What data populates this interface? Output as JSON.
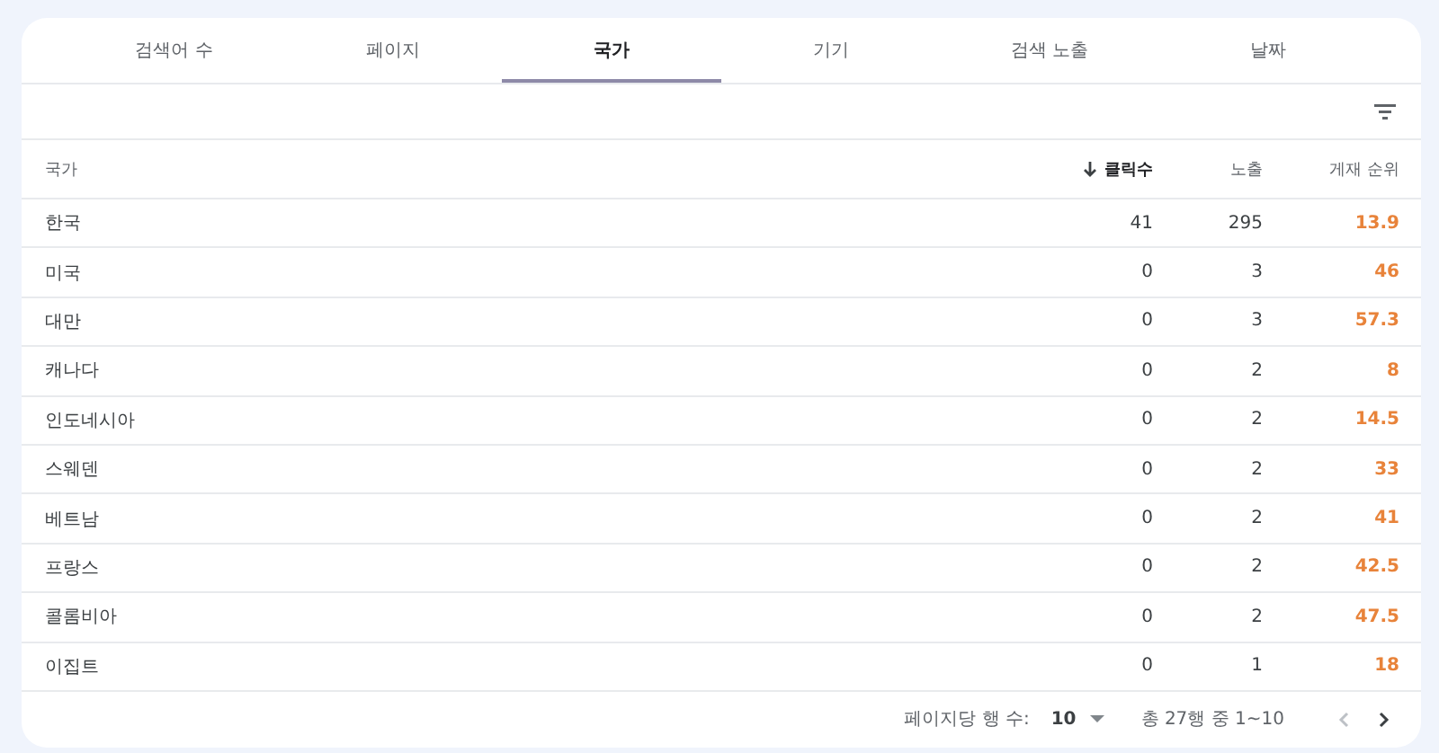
{
  "tabs": [
    {
      "label": "검색어 수",
      "selected": false
    },
    {
      "label": "페이지",
      "selected": false
    },
    {
      "label": "국가",
      "selected": true
    },
    {
      "label": "기기",
      "selected": false
    },
    {
      "label": "검색 노출",
      "selected": false
    },
    {
      "label": "날짜",
      "selected": false
    }
  ],
  "table": {
    "columns": [
      {
        "label": "국가",
        "sorted": false
      },
      {
        "label": "클릭수",
        "sorted": true
      },
      {
        "label": "노출",
        "sorted": false
      },
      {
        "label": "게재 순위",
        "sorted": false
      }
    ],
    "rows": [
      [
        "한국",
        "41",
        "295",
        "13.9"
      ],
      [
        "미국",
        "0",
        "3",
        "46"
      ],
      [
        "대만",
        "0",
        "3",
        "57.3"
      ],
      [
        "캐나다",
        "0",
        "2",
        "8"
      ],
      [
        "인도네시아",
        "0",
        "2",
        "14.5"
      ],
      [
        "스웨덴",
        "0",
        "2",
        "33"
      ],
      [
        "베트남",
        "0",
        "2",
        "41"
      ],
      [
        "프랑스",
        "0",
        "2",
        "42.5"
      ],
      [
        "콜롬비아",
        "0",
        "2",
        "47.5"
      ],
      [
        "이집트",
        "0",
        "1",
        "18"
      ]
    ]
  },
  "pagination": {
    "rows_per_page_label": "페이지당 행 수:",
    "rows_per_page": "10",
    "range": "총 27행 중 1~10",
    "prev_disabled": true,
    "next_disabled": false
  }
}
